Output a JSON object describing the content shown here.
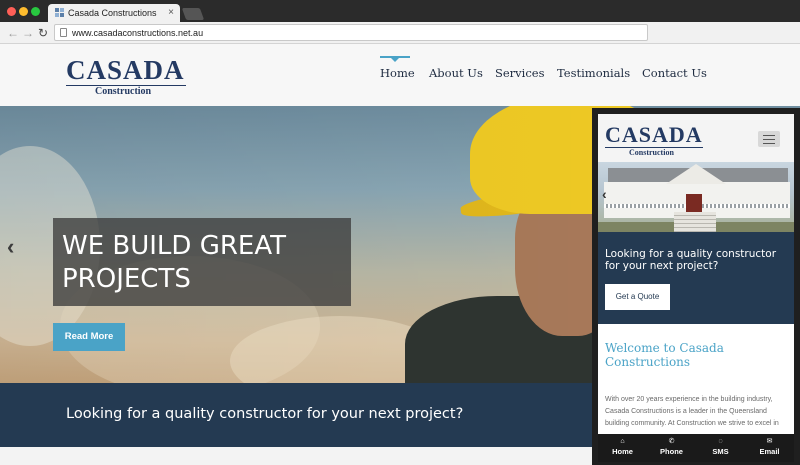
{
  "browser": {
    "tab_title": "Casada Constructions",
    "tab_close": "×",
    "url": "www.casadaconstructions.net.au",
    "icons": {
      "back": "back-arrow-icon",
      "forward": "forward-arrow-icon",
      "reload": "reload-icon",
      "page": "document-icon"
    }
  },
  "site": {
    "logo": {
      "main": "CASADA",
      "sub": "Construction"
    },
    "nav": [
      {
        "label": "Home",
        "active": true
      },
      {
        "label": "About Us"
      },
      {
        "label": "Services"
      },
      {
        "label": "Testimonials"
      },
      {
        "label": "Contact Us"
      }
    ],
    "hero": {
      "headline": "WE BUILD GREAT PROJECTS",
      "button_label": "Read More",
      "prev_arrow": "‹"
    },
    "cta_text": "Looking for a quality constructor for your next project?",
    "accent_color": "#4aa3c7",
    "brand_color": "#243a63",
    "band_color": "#243a52"
  },
  "mobile": {
    "logo_main": "CASADA",
    "logo_sub": "Construction",
    "prev_arrow": "‹",
    "cta_text": "Looking for a quality constructor for your next project?",
    "quote_button": "Get a Quote",
    "welcome_title": "Welcome to Casada Constructions",
    "body_text": "With over 20 years experience in the building industry, Casada Constructions is a leader in the Queensland building community. At Construction we strive to excel in",
    "bottom_nav": [
      {
        "label": "Home",
        "icon": "home-icon",
        "glyph": "⌂"
      },
      {
        "label": "Phone",
        "icon": "phone-icon",
        "glyph": "✆"
      },
      {
        "label": "SMS",
        "icon": "chat-icon",
        "glyph": "◌"
      },
      {
        "label": "Email",
        "icon": "envelope-icon",
        "glyph": "✉"
      }
    ]
  }
}
